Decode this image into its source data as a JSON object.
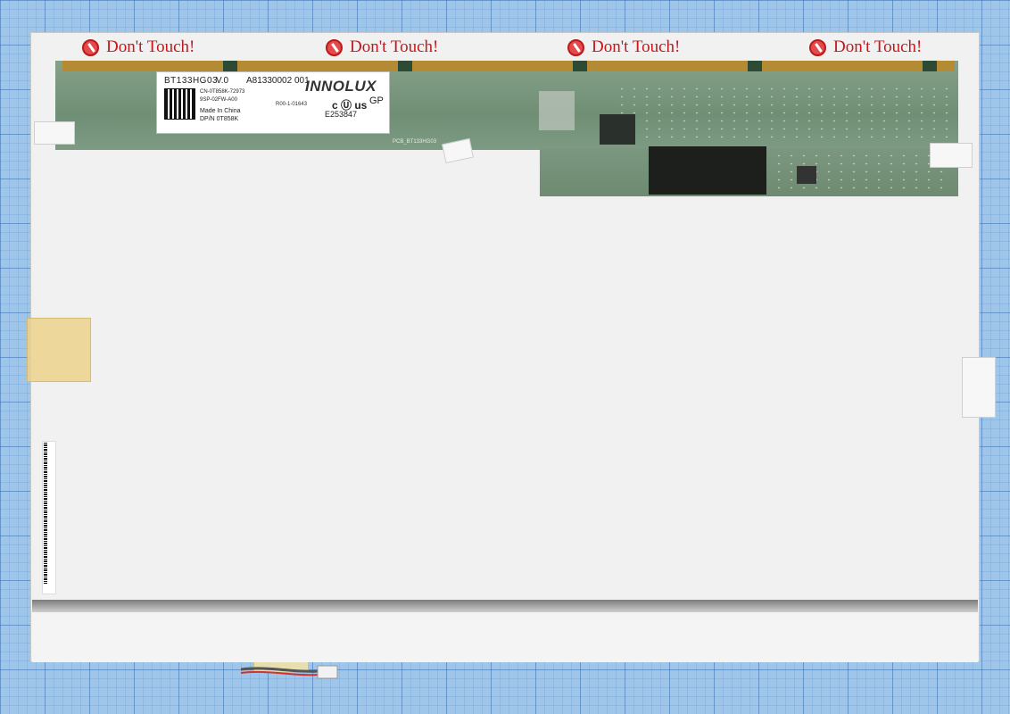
{
  "warning_labels": [
    "Don't Touch!",
    "Don't Touch!",
    "Don't Touch!",
    "Don't Touch!"
  ],
  "product_label": {
    "model": "BT133HG03",
    "version": "V.0",
    "serial": "A81330002   001",
    "cn_code": "CN-0T858K-72973",
    "part_code": "9SP-02FW-A00",
    "origin": "Made In China",
    "dpn": "DP/N 0T858K",
    "brand": "INNOLUX",
    "ul_mark": "c Ⓤ us",
    "gp_mark": "GP",
    "cert": "E253847"
  },
  "pcb_codes": {
    "code1": "R00-1-01643",
    "pcb_name": "PCB_BT133HG03"
  },
  "colors": {
    "warning_text": "#c4171b",
    "pcb_green": "#7a957e",
    "panel_white": "#f1f1f1",
    "grid_blue": "#9fc6e8"
  }
}
